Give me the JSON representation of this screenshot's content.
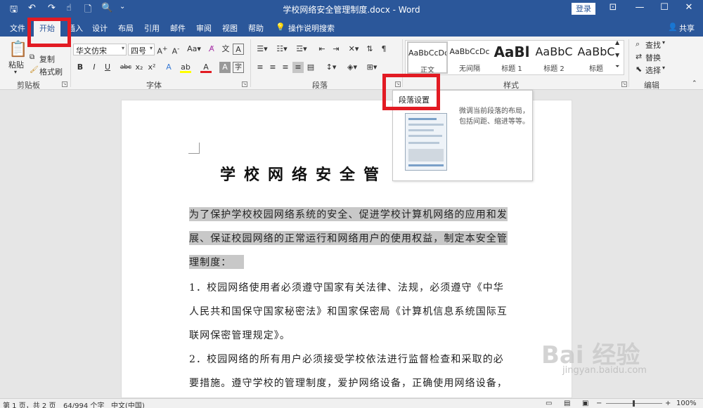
{
  "window": {
    "title": "学校网络安全管理制度.docx - Word",
    "login_label": "登录",
    "share_label": "共享"
  },
  "tabs": [
    {
      "label": "文件"
    },
    {
      "label": "开始"
    },
    {
      "label": "插入"
    },
    {
      "label": "设计"
    },
    {
      "label": "布局"
    },
    {
      "label": "引用"
    },
    {
      "label": "邮件"
    },
    {
      "label": "审阅"
    },
    {
      "label": "视图"
    },
    {
      "label": "帮助"
    },
    {
      "label": "操作说明搜索"
    }
  ],
  "ribbon": {
    "clipboard": {
      "group_label": "剪贴板",
      "paste": "粘贴",
      "copy": "复制",
      "format_painter": "格式刷"
    },
    "font": {
      "group_label": "字体",
      "font_name": "华文仿宋",
      "font_size": "四号"
    },
    "paragraph": {
      "group_label": "段落"
    },
    "styles": {
      "group_label": "样式",
      "items": [
        {
          "sample": "AaBbCcDc",
          "name": "正文"
        },
        {
          "sample": "AaBbCcDc",
          "name": "无间隔"
        },
        {
          "sample": "AaBl",
          "name": "标题 1"
        },
        {
          "sample": "AaBbC",
          "name": "标题 2"
        },
        {
          "sample": "AaBbC",
          "name": "标题"
        }
      ]
    },
    "editing": {
      "group_label": "编辑",
      "find": "查找",
      "replace": "替换",
      "select": "选择"
    }
  },
  "tooltip": {
    "title": "段落设置",
    "description": "微调当前段落的布局，包括间距、缩进等等。"
  },
  "document": {
    "heading": "学校网络安全管",
    "lines": [
      "为了保护学校校园网络系统的安全、促进学校计算机网络的应用和发",
      "展、保证校园网络的正常运行和网络用户的使用权益，制定本安全管",
      "理制度：",
      "1．校园网络使用者必须遵守国家有关法律、法规，必须遵守《中华",
      "人民共和国保守国家秘密法》和国家保密局《计算机信息系统国际互",
      "联网保密管理规定》。",
      "2．校园网络的所有用户必须接受学校依法进行监督检查和采取的必",
      "要措施。遵守学校的管理制度，爱护网络设备，正确使用网络设备，"
    ]
  },
  "statusbar": {
    "page": "第 1 页，共 2 页",
    "words": "64/994 个字",
    "language": "中文(中国)",
    "zoom": "100%"
  },
  "watermark": {
    "text": "Bai 经验",
    "url": "jingyan.baidu.com"
  },
  "colors": {
    "word_blue": "#2b579a",
    "highlight_red": "#e21b23",
    "selection_gray": "#c8c8c8"
  }
}
